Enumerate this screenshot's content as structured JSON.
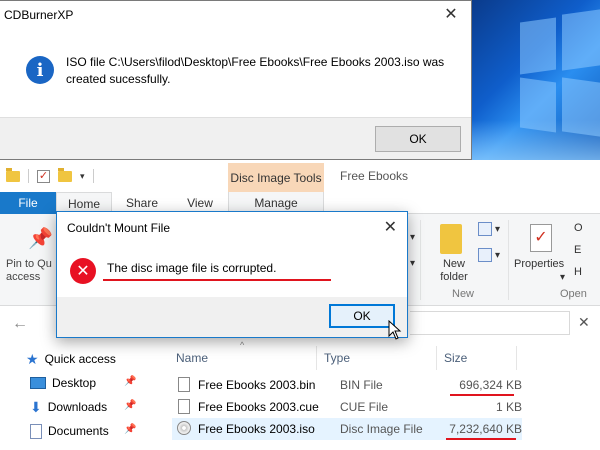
{
  "cdburner": {
    "title": "CDBurnerXP",
    "close": "✕",
    "message": "ISO file C:\\Users\\filod\\Desktop\\Free Ebooks\\Free Ebooks 2003.iso was created sucessfully.",
    "ok_label": "OK"
  },
  "explorer": {
    "context_tab": "Disc Image Tools",
    "window_title": "Free Ebooks",
    "tabs": {
      "file": "File",
      "home": "Home",
      "share": "Share",
      "view": "View",
      "manage": "Manage"
    },
    "ribbon": {
      "pin_label": "Pin to Qu access",
      "new_folder": "New folder",
      "new_group": "New",
      "properties": "Properties",
      "open_group": "Open",
      "right_o": "O",
      "right_e": "E",
      "right_h": "H"
    },
    "sidebar": {
      "quick_access": "Quick access",
      "desktop": "Desktop",
      "downloads": "Downloads",
      "documents": "Documents"
    },
    "columns": {
      "name": "Name",
      "type": "Type",
      "size": "Size"
    },
    "files": [
      {
        "name": "Free Ebooks 2003.bin",
        "type": "BIN File",
        "size": "696,324 KB"
      },
      {
        "name": "Free Ebooks 2003.cue",
        "type": "CUE File",
        "size": "1 KB"
      },
      {
        "name": "Free Ebooks 2003.iso",
        "type": "Disc Image File",
        "size": "7,232,640 KB"
      }
    ]
  },
  "mount_dialog": {
    "title": "Couldn't Mount File",
    "close": "✕",
    "message": "The disc image file is corrupted.",
    "ok_label": "OK"
  },
  "colors": {
    "accent": "#1979ca",
    "error": "#e81123",
    "highlight": "#e0141e"
  }
}
